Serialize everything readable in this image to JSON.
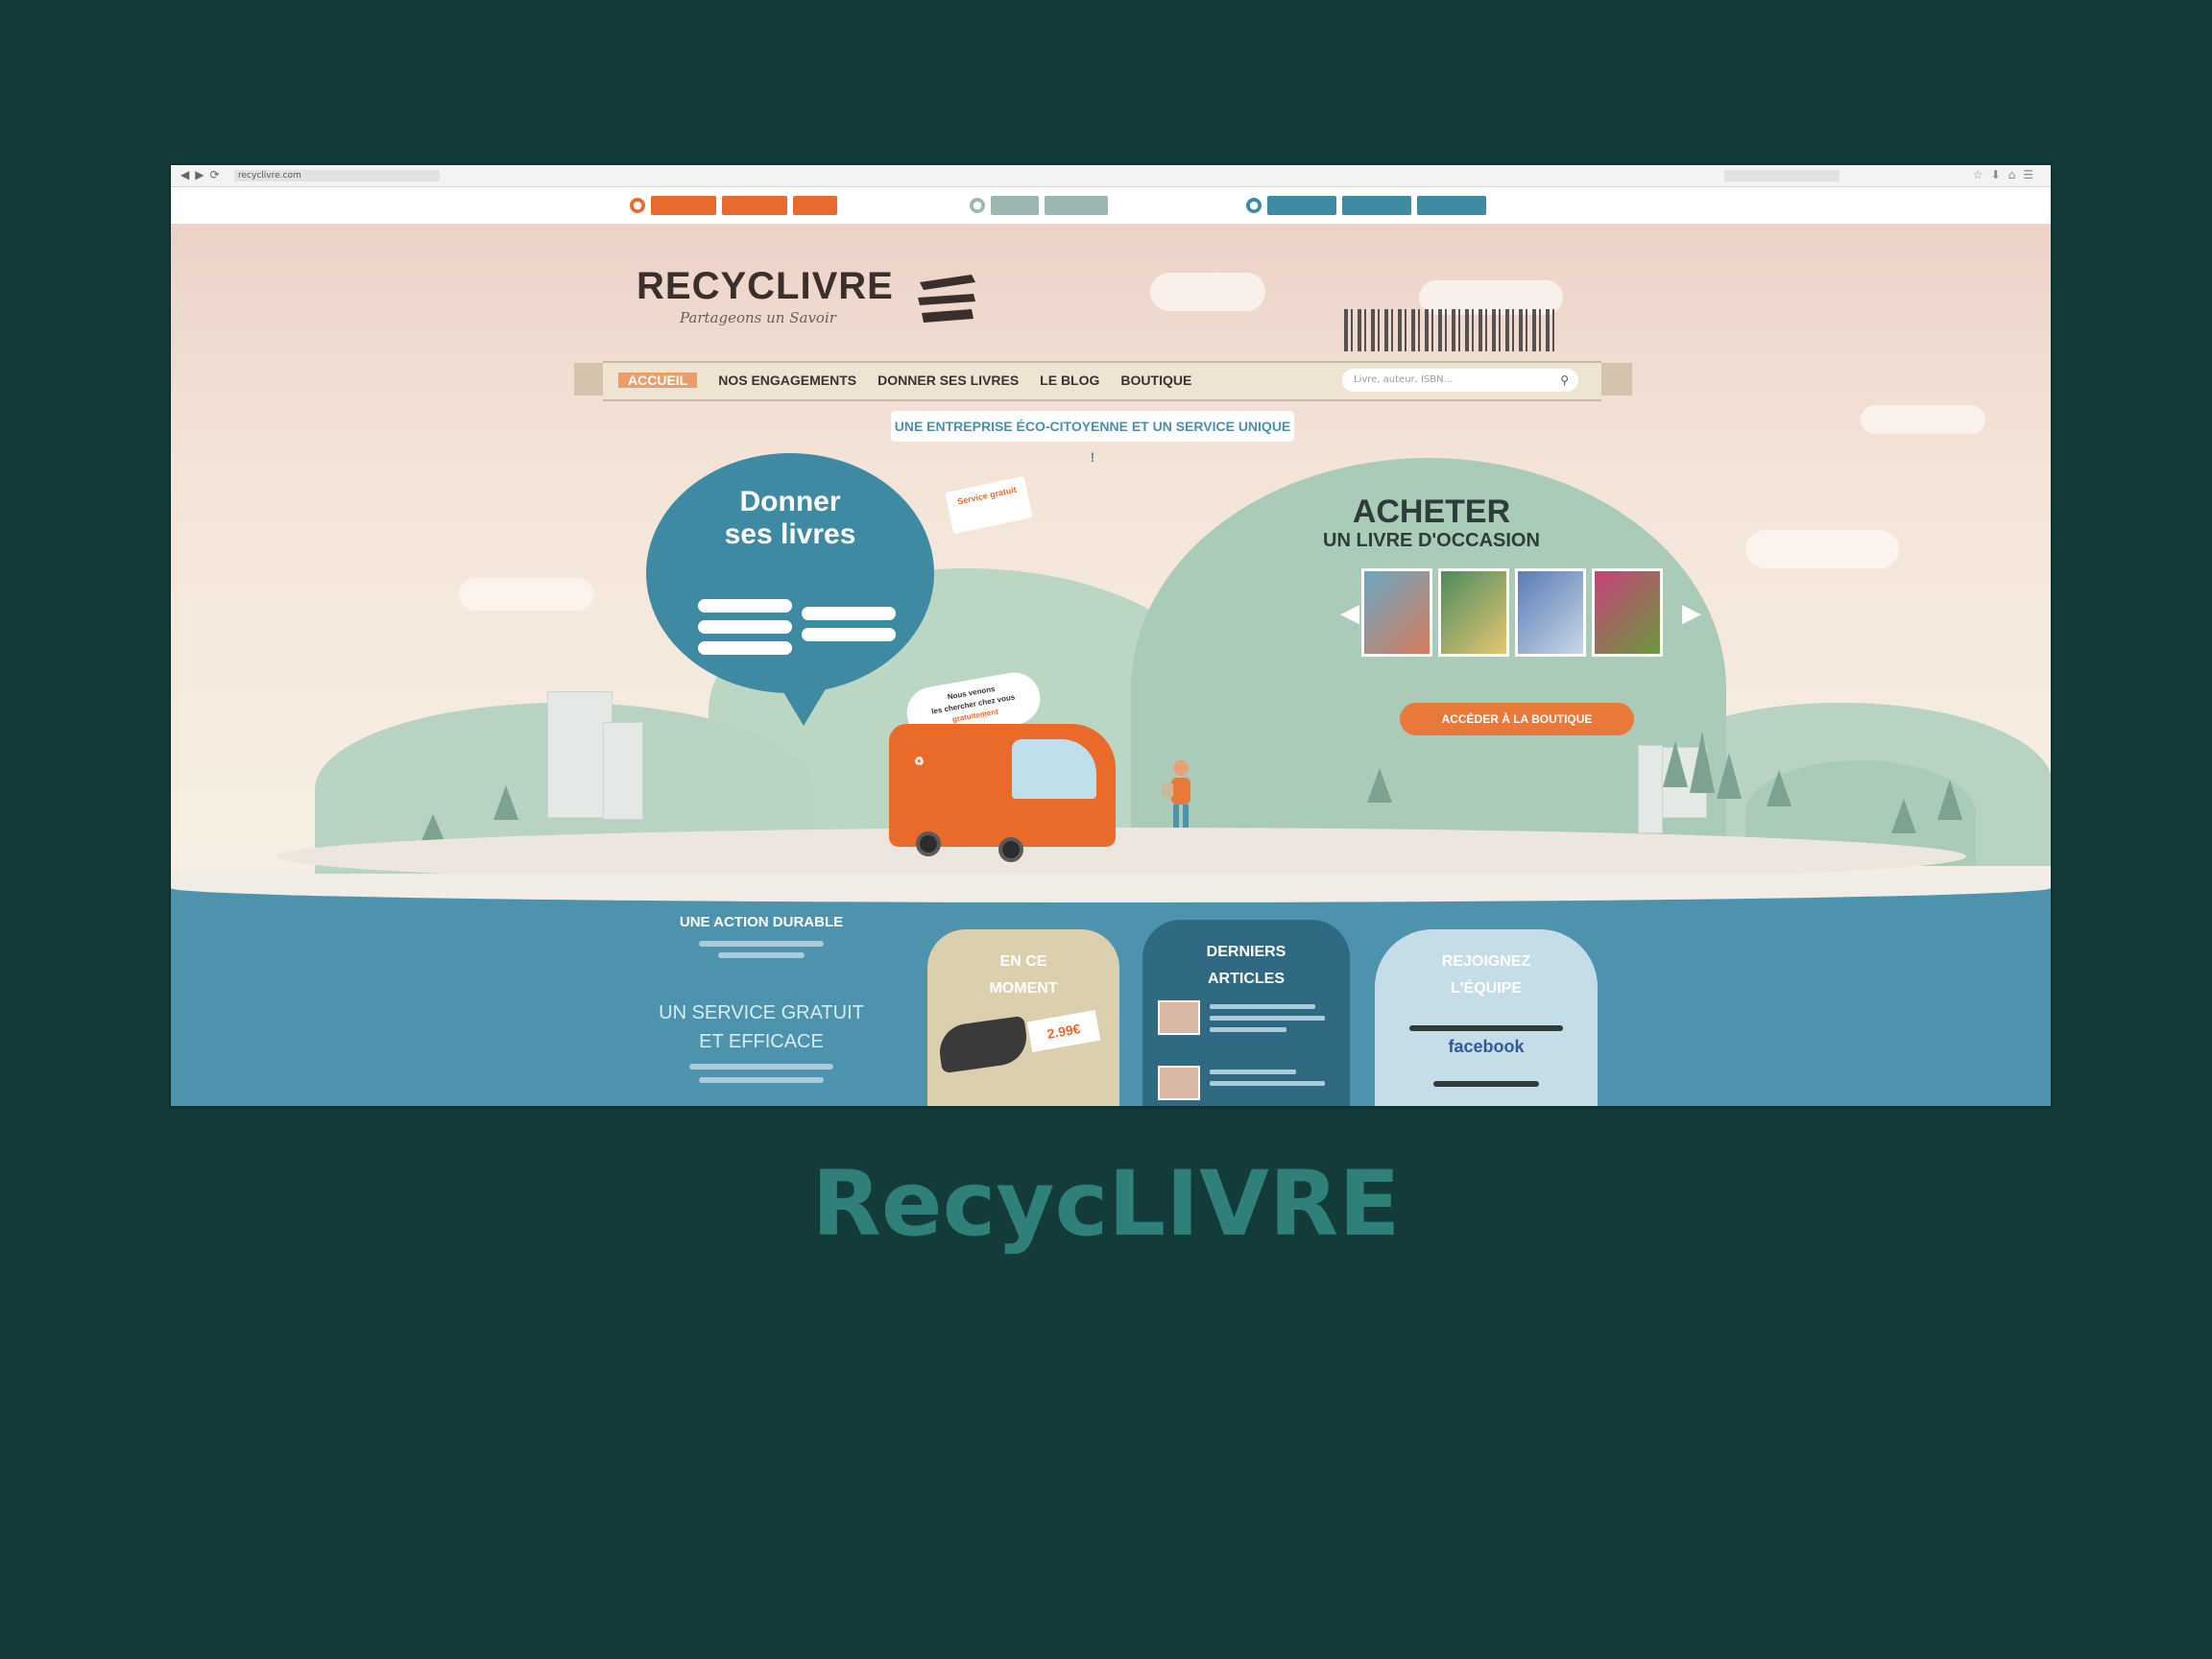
{
  "browser": {
    "url": "recyclivre.com"
  },
  "site": {
    "logo_main": "RECYCLIVRE",
    "tagline": "Partageons un Savoir"
  },
  "nav": {
    "items": [
      "Accueil",
      "Nos engagements",
      "Donner ses livres",
      "Le blog",
      "Boutique"
    ],
    "search_placeholder": "Livre, auteur, ISBN..."
  },
  "slogan": "Une entreprise éco-citoyenne et un service unique !",
  "donate": {
    "title_line1": "Donner",
    "title_line2": "ses livres",
    "badge": "Service gratuit",
    "pickup_badge_line1": "Nous venons",
    "pickup_badge_line2": "les chercher chez vous",
    "pickup_badge_line3": "gratuitement"
  },
  "buy": {
    "title": "Acheter",
    "subtitle": "un livre d'occasion",
    "shop_button": "Accéder à la boutique"
  },
  "bottom": {
    "action_title": "Une action durable",
    "service_title_line1": "Un service gratuit",
    "service_title_line2": "et efficace",
    "panel_moment_title_line1": "En ce",
    "panel_moment_title_line2": "moment",
    "price": "2.99€",
    "panel_articles_title_line1": "Derniers",
    "panel_articles_title_line2": "articles",
    "panel_social_title_line1": "Rejoignez",
    "panel_social_title_line2": "l'équipe",
    "facebook_label": "facebook"
  },
  "caption": "RecycLIVRE",
  "colors": {
    "page_background": "#123b3a",
    "caption": "#2e8079",
    "accent_orange": "#e8793a",
    "water_blue": "#4d93ae",
    "hill_green": "#a9cbb7"
  }
}
